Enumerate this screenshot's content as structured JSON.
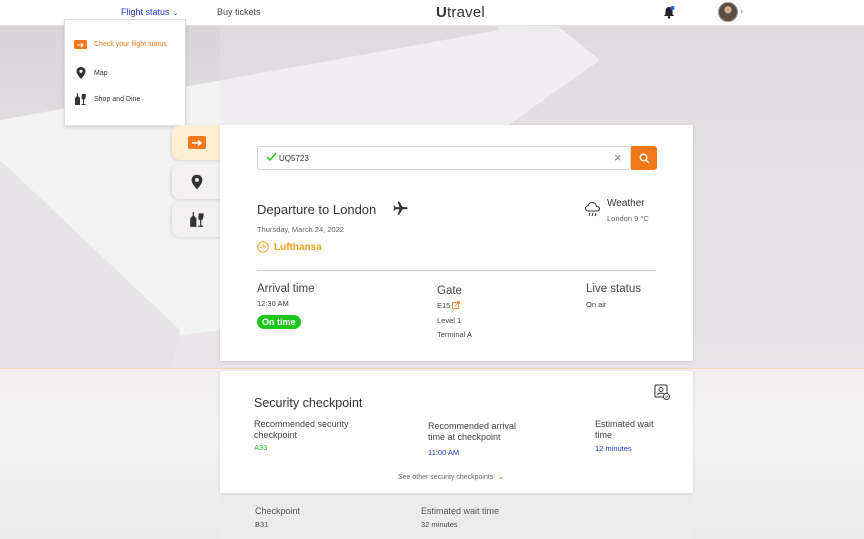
{
  "header": {
    "nav_flight_status": "Flight status",
    "nav_buy_tickets": "Buy tickets",
    "logo_first": "U",
    "logo_rest": "travel"
  },
  "dropdown": {
    "items": [
      {
        "label": "Check your flight status",
        "icon": "flight-status-icon"
      },
      {
        "label": "Map",
        "icon": "map-pin-icon"
      },
      {
        "label": "Shop and Dine",
        "icon": "shop-dine-icon"
      }
    ]
  },
  "search": {
    "value": "UQ5723"
  },
  "flight": {
    "title": "Departure to London",
    "date": "Thursday, March 24, 2022",
    "airline": "Lufthansa",
    "weather_label": "Weather",
    "weather_value": "London 9 °C",
    "arrival_label": "Arrival time",
    "arrival_value": "12:30 AM",
    "status_badge": "On time",
    "gate_label": "Gate",
    "gate_value": "E15",
    "gate_level": "Level 1",
    "gate_terminal": "Terminal A",
    "live_label": "Live status",
    "live_value": "On air"
  },
  "security": {
    "title": "Security checkpoint",
    "recommended_checkpoint_label_1": "Recommended security",
    "recommended_checkpoint_label_2": "checkpoint",
    "recommended_checkpoint_value": "A33",
    "recommended_arrival_label_1": "Recommended arrival",
    "recommended_arrival_label_2": "time at  checkpoint",
    "recommended_arrival_value": "11:00 AM",
    "wait_label_1": "Estimated wait",
    "wait_label_2": "time",
    "wait_value": "12 minutes",
    "see_other": "See other security checkpoints"
  },
  "other_checkpoint": {
    "checkpoint_label": "Checkpoint",
    "checkpoint_value": "B31",
    "wait_label": "Estimated wait time",
    "wait_value": "32 minutes"
  },
  "colors": {
    "accent": "#f07a1a",
    "nav_active": "#2338c9",
    "on_time": "#1ec61e",
    "airline": "#f0a21a"
  }
}
